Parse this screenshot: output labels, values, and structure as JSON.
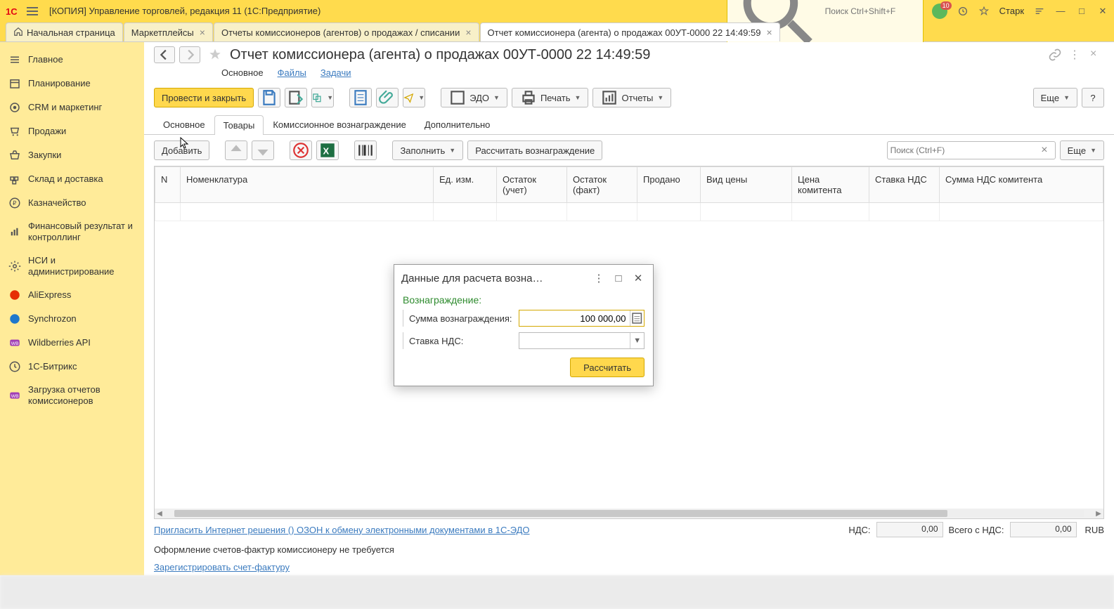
{
  "titlebar": {
    "app_title": "[КОПИЯ] Управление торговлей, редакция 11  (1С:Предприятие)",
    "search_placeholder": "Поиск Ctrl+Shift+F",
    "star_user": "Старк"
  },
  "tabs": [
    {
      "label": "Начальная страница",
      "home": true
    },
    {
      "label": "Маркетплейсы",
      "closable": true
    },
    {
      "label": "Отчеты комиссионеров (агентов) о продажах / списании",
      "closable": true
    },
    {
      "label": "Отчет комиссионера (агента) о продажах 00УТ-0000            22 14:49:59",
      "closable": true,
      "active": true
    }
  ],
  "sidebar": {
    "items": [
      {
        "label": "Главное",
        "icon": "menu-icon"
      },
      {
        "label": "Планирование",
        "icon": "calendar-icon"
      },
      {
        "label": "CRM и маркетинг",
        "icon": "target-icon"
      },
      {
        "label": "Продажи",
        "icon": "cart-icon"
      },
      {
        "label": "Закупки",
        "icon": "basket-icon"
      },
      {
        "label": "Склад и доставка",
        "icon": "warehouse-icon"
      },
      {
        "label": "Казначейство",
        "icon": "ruble-icon"
      },
      {
        "label": "Финансовый результат и контроллинг",
        "icon": "chart-icon"
      },
      {
        "label": "НСИ и администрирование",
        "icon": "gear-icon"
      },
      {
        "label": "AliExpress",
        "icon": "aliexpress-icon"
      },
      {
        "label": "Synchrozon",
        "icon": "sync-icon"
      },
      {
        "label": "Wildberries API",
        "icon": "wb-icon"
      },
      {
        "label": "1С-Битрикс",
        "icon": "bitrix-icon"
      },
      {
        "label": "Загрузка отчетов комиссионеров",
        "icon": "wb-icon"
      }
    ]
  },
  "doc": {
    "title": "Отчет комиссионера (агента) о продажах 00УТ-0000                22 14:49:59"
  },
  "info_links": {
    "main": "Основное",
    "files": "Файлы",
    "tasks": "Задачи"
  },
  "toolbar": {
    "post_close": "Провести и закрыть",
    "edo": "ЭДО",
    "print": "Печать",
    "reports": "Отчеты",
    "more": "Еще"
  },
  "subtabs": {
    "main": "Основное",
    "goods": "Товары",
    "commission": "Комиссионное вознаграждение",
    "extra": "Дополнительно"
  },
  "goods_toolbar": {
    "add": "Добавить",
    "fill": "Заполнить",
    "calc": "Рассчитать вознаграждение",
    "search_placeholder": "Поиск (Ctrl+F)",
    "more": "Еще"
  },
  "grid": {
    "columns": [
      "N",
      "Номенклатура",
      "Ед. изм.",
      "Остаток (учет)",
      "Остаток (факт)",
      "Продано",
      "Вид цены",
      "Цена комитента",
      "Ставка НДС",
      "Сумма НДС комитента"
    ]
  },
  "footer": {
    "invite_link": "Пригласить Интернет решения () ОЗОН к обмену электронными документами в 1С-ЭДО",
    "nds_label": "НДС:",
    "nds_value": "0,00",
    "total_label": "Всего с НДС:",
    "total_value": "0,00",
    "currency": "RUB",
    "invoice_msg": "Оформление счетов-фактур комиссионеру не требуется",
    "register_link": "Зарегистрировать счет-фактуру"
  },
  "modal": {
    "title": "Данные для расчета возна…",
    "section": "Вознаграждение:",
    "sum_label": "Сумма вознаграждения:",
    "sum_value": "100 000,00",
    "vat_label": "Ставка НДС:",
    "vat_value": "",
    "calc_btn": "Рассчитать"
  }
}
